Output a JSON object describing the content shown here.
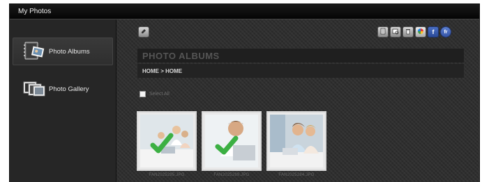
{
  "window": {
    "title": "My Photos"
  },
  "sidebar": {
    "items": [
      {
        "label": "Photo Albums",
        "icon": "photo-album-icon",
        "active": true
      },
      {
        "label": "Photo Gallery",
        "icon": "photo-gallery-icon",
        "active": false
      }
    ]
  },
  "toolbar": {
    "left": [
      {
        "icon": "edit-icon"
      }
    ],
    "right": [
      {
        "icon": "properties-icon"
      },
      {
        "icon": "slideshow-icon"
      },
      {
        "icon": "delete-icon"
      },
      {
        "icon": "picasa-icon"
      },
      {
        "icon": "facebook-icon",
        "glyph": "f"
      },
      {
        "icon": "flickr-icon",
        "glyph": "fr"
      }
    ]
  },
  "main": {
    "heading": "PHOTO ALBUMS",
    "breadcrumb": "HOME > HOME",
    "select_all_label": "Select All",
    "photos": [
      {
        "filename": "FAN2025295.JPG",
        "selected": true
      },
      {
        "filename": "FAN2025289.JPG",
        "selected": true
      },
      {
        "filename": "FAN2025284.JPG",
        "selected": false
      }
    ]
  },
  "colors": {
    "check_green": "#3cb043",
    "background": "#2b2b2b",
    "title_bar": "#0d0d0d"
  }
}
